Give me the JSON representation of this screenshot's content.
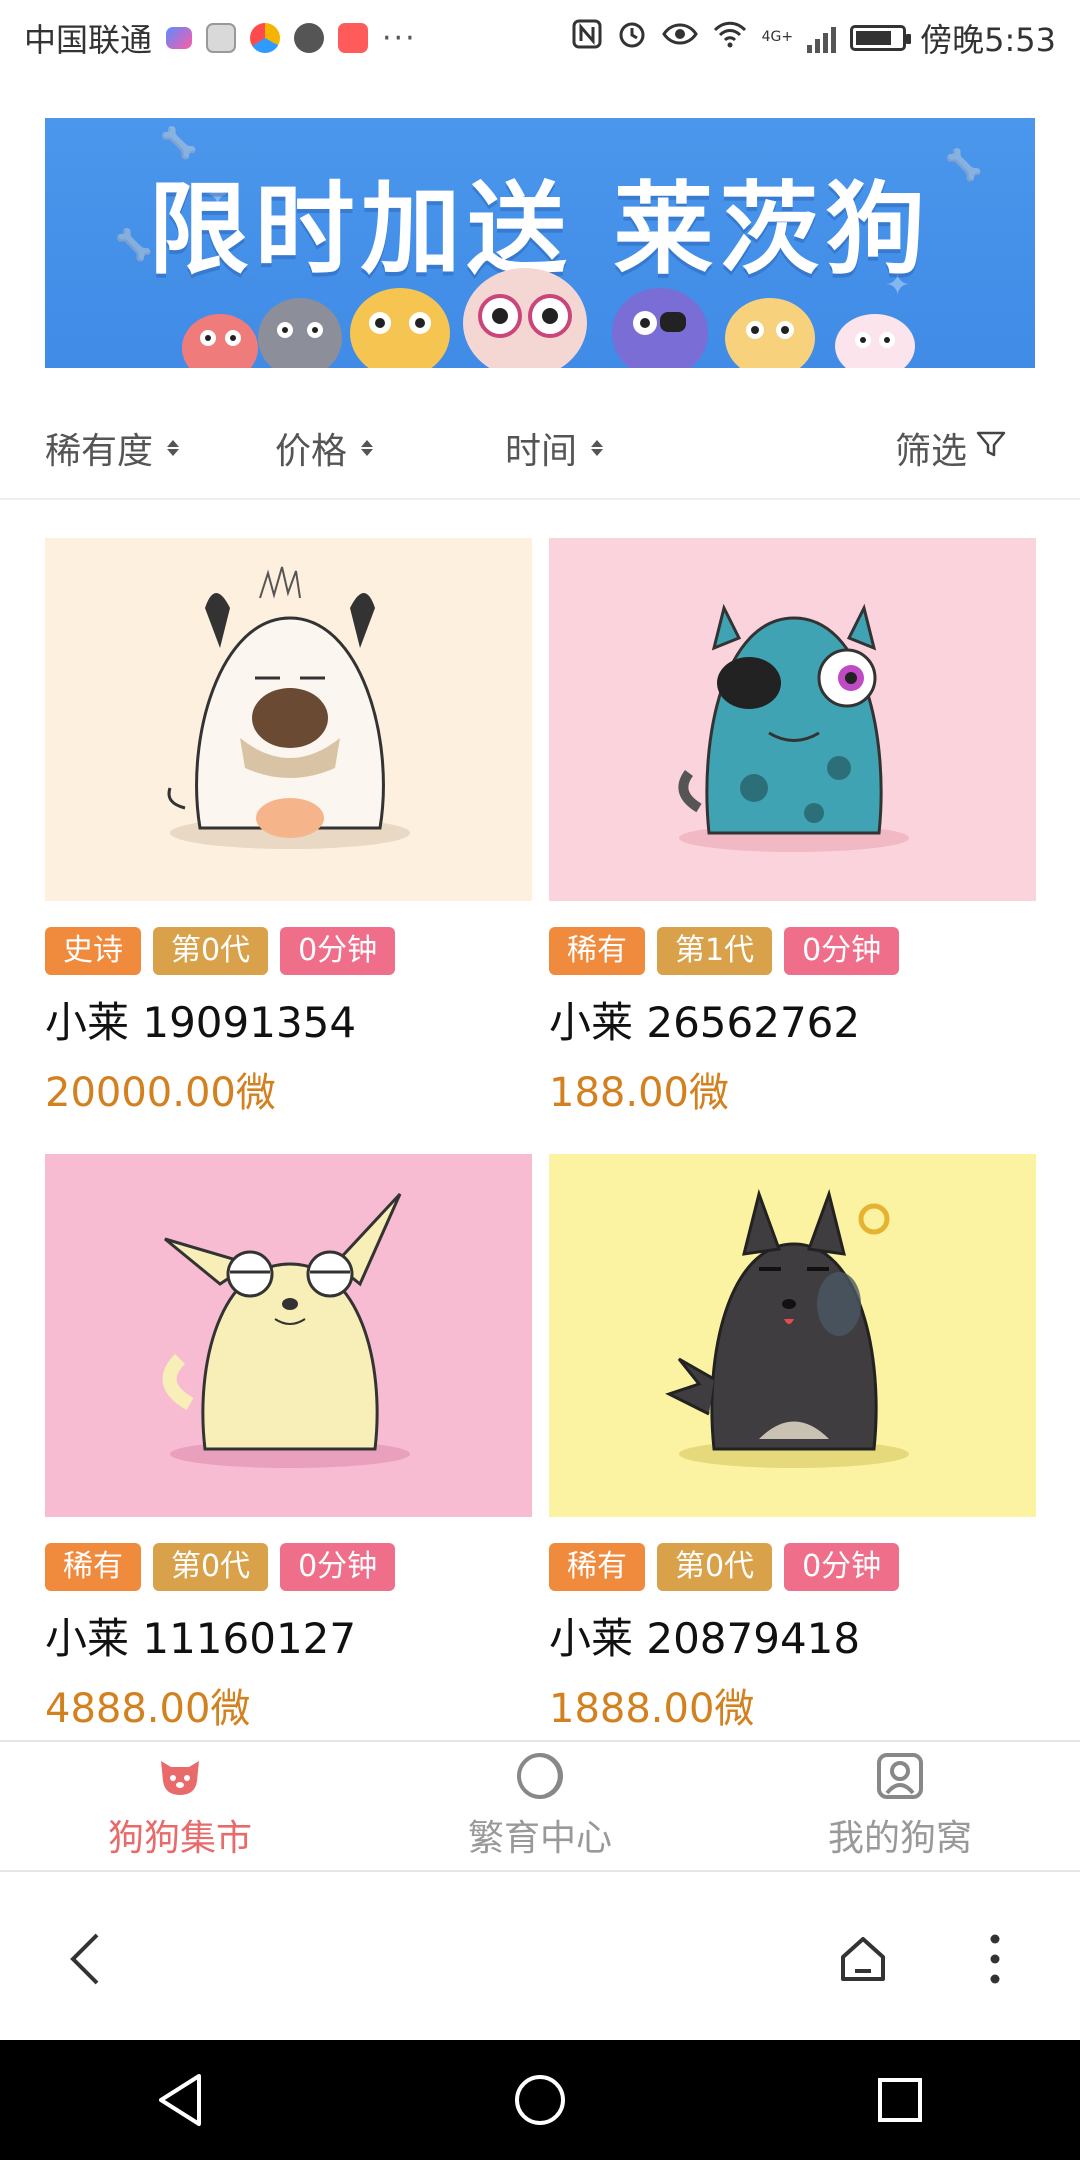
{
  "status_bar": {
    "carrier": "中国联通",
    "more": "···",
    "time": "傍晚5:53",
    "battery_level": 0.8,
    "network_label": "4G+"
  },
  "banner": {
    "title": "限时加送 莱茨狗"
  },
  "filters": {
    "rarity": "稀有度",
    "price": "价格",
    "time": "时间",
    "filter": "筛选"
  },
  "cards": [
    {
      "tags": [
        "史诗",
        "第0代",
        "0分钟"
      ],
      "name": "小莱 19091354",
      "price": "20000.00微",
      "bg": "#fdf0df",
      "dog": "white-dog"
    },
    {
      "tags": [
        "稀有",
        "第1代",
        "0分钟"
      ],
      "name": "小莱 26562762",
      "price": "188.00微",
      "bg": "#fbd3dc",
      "dog": "teal-pirate-dog"
    },
    {
      "tags": [
        "稀有",
        "第0代",
        "0分钟"
      ],
      "name": "小莱 11160127",
      "price": "4888.00微",
      "bg": "#f8bcd2",
      "dog": "chihuahua-dog"
    },
    {
      "tags": [
        "稀有",
        "第0代",
        "0分钟"
      ],
      "name": "小莱 20879418",
      "price": "1888.00微",
      "bg": "#fbf2a2",
      "dog": "black-dog"
    }
  ],
  "tabbar": {
    "items": [
      {
        "label": "狗狗集市",
        "active": true,
        "icon": "dog-face-icon"
      },
      {
        "label": "繁育中心",
        "active": false,
        "icon": "circle-icon"
      },
      {
        "label": "我的狗窝",
        "active": false,
        "icon": "profile-icon"
      }
    ]
  },
  "browser": {
    "icons": [
      "back-icon",
      "home-icon",
      "more-vertical-icon"
    ]
  },
  "navbar": {
    "icons": [
      "nav-back-icon",
      "nav-home-icon",
      "nav-recents-icon"
    ]
  },
  "colors": {
    "accent": "#e86a6a",
    "price": "#d3801e",
    "banner": "#4b97ec"
  }
}
